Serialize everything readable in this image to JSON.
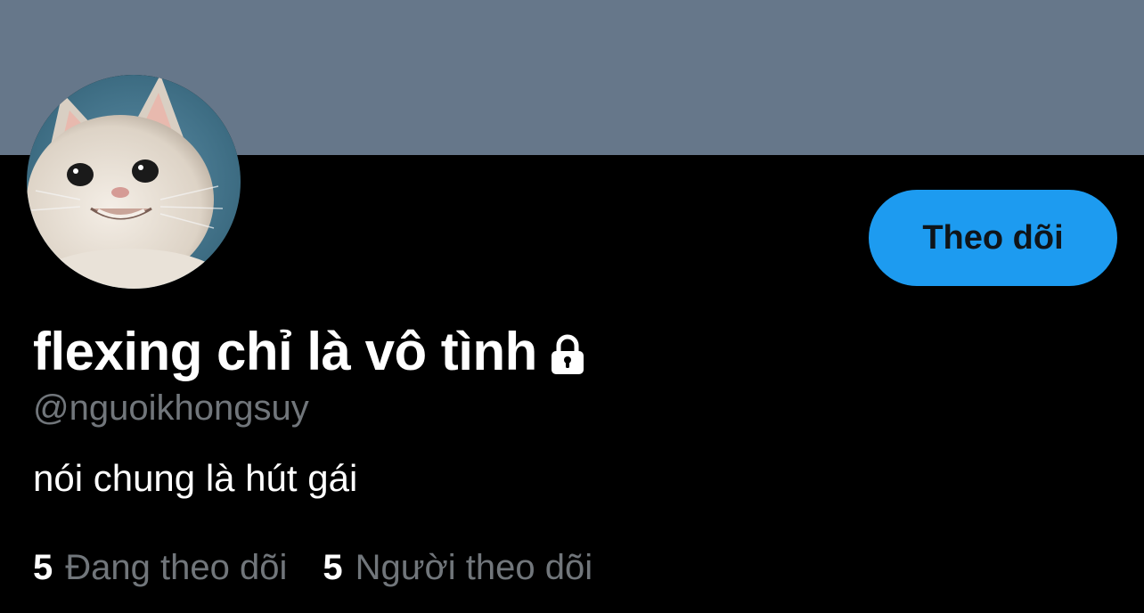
{
  "profile": {
    "display_name": "flexing chỉ là vô tình",
    "handle": "@nguoikhongsuy",
    "bio": "nói chung là hút gái",
    "is_protected": true,
    "lock_icon": "lock-icon",
    "avatar_icon": "avatar-cat"
  },
  "actions": {
    "follow_label": "Theo dõi"
  },
  "stats": {
    "following_count": "5",
    "following_label": "Đang theo dõi",
    "followers_count": "5",
    "followers_label": "Người theo dõi"
  },
  "colors": {
    "banner": "#66778a",
    "background": "#000000",
    "accent": "#1d9bf0",
    "secondary_text": "#71767b"
  }
}
